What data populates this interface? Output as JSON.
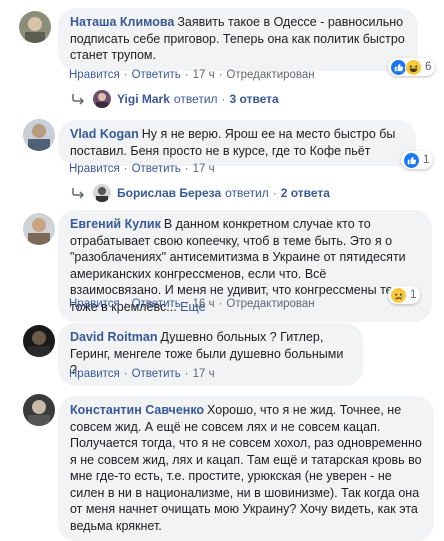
{
  "comments": [
    {
      "author": "Наташа Климова",
      "text": "Заявить такое в Одессе - равносильно подписать себе приговор. Теперь она как политик быстро станет трупом.",
      "like": "Нравится",
      "reply": "Ответить",
      "time": "17 ч",
      "edited": "Отредактирован",
      "reactions": [
        "like-icon",
        "haha-icon"
      ],
      "reaction_count": "6",
      "replies": {
        "name": "Yigi Mark",
        "verb": "ответил",
        "count": "3 ответа"
      }
    },
    {
      "author": "Vlad Kogan",
      "text": "Ну я не верю. Ярош ее на место быстро бы поставил. Беня просто не в курсе, где то Кофе пьёт",
      "like": "Нравится",
      "reply": "Ответить",
      "time": "17 ч",
      "reactions": [
        "like-icon"
      ],
      "reaction_count": "1",
      "replies": {
        "name": "Борислав Береза",
        "verb": "ответил",
        "count": "2 ответа"
      }
    },
    {
      "author": "Евгений Кулик",
      "text": "В данном конкретном случае кто то отрабатывает свою копеечку, чтоб в теме быть. Это я о \"разоблачениях\" антисемитизма в Украине от пятидесяти американских конгрессменов, если что. Всё взаимосвязано. И меня не удивит, что конгрессмены те тоже в кремлёвс...",
      "more": "Еще",
      "like": "Нравится",
      "reply": "Ответить",
      "time": "16 ч",
      "edited": "Отредактирован",
      "reactions": [
        "sad-icon"
      ],
      "reaction_count": "1"
    },
    {
      "author": "David Roitman",
      "text": "Душевно больных ? Гитлер, Геринг, менгеле тоже были душевно больными ?",
      "like": "Нравится",
      "reply": "Ответить",
      "time": "17 ч"
    },
    {
      "author": "Константин Савченко",
      "text": "Хорошо, что я не жид. Точнее, не совсем жид. А ещё не совсем лях и не совсем кацап. Получается тогда, что я не совсем хохол, раз одновременно я не совсем жид, лях и кацап. Там ещё и татарская кровь во мне где-то есть, т.е. простите, урюкская (не уверен - не силен в ни в национализме, ни в шовинизме). Так когда она от меня начнет очищать мою Украину? Хочу видеть, как эта ведьма крякнет."
    }
  ]
}
